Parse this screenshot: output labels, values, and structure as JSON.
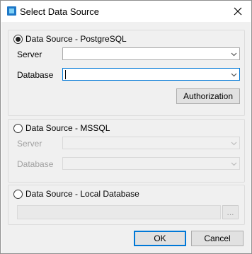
{
  "window": {
    "title": "Select Data Source",
    "icon": "database-app-icon"
  },
  "postgres": {
    "label": "Data Source - PostgreSQL",
    "selected": true,
    "server_label": "Server",
    "server_value": "",
    "database_label": "Database",
    "database_value": "",
    "authorization_label": "Authorization"
  },
  "mssql": {
    "label": "Data Source - MSSQL",
    "selected": false,
    "server_label": "Server",
    "server_value": "",
    "database_label": "Database",
    "database_value": ""
  },
  "local": {
    "label": "Data Source - Local Database",
    "selected": false,
    "path_value": "",
    "browse_label": "..."
  },
  "footer": {
    "ok_label": "OK",
    "cancel_label": "Cancel"
  },
  "colors": {
    "accent": "#0078d7",
    "background": "#f0f0f0"
  }
}
